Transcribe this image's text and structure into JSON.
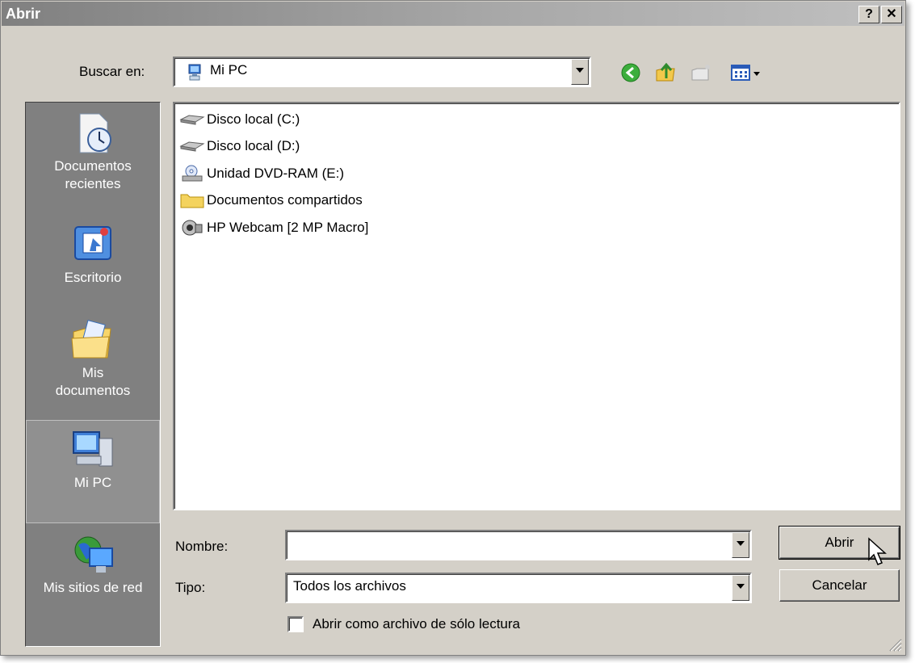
{
  "window": {
    "title": "Abrir",
    "help_label": "?",
    "close_label": "✕"
  },
  "lookin": {
    "label": "Buscar en:",
    "value": "Mi PC",
    "icon": "computer-icon"
  },
  "toolbar": {
    "back": "back-arrow-icon",
    "up": "up-folder-icon",
    "new_folder": "new-folder-icon",
    "views": "views-menu-icon"
  },
  "places": [
    {
      "label_line1": "Documentos",
      "label_line2": "recientes",
      "icon": "recent-documents-icon"
    },
    {
      "label_line1": "Escritorio",
      "label_line2": "",
      "icon": "desktop-icon"
    },
    {
      "label_line1": "Mis",
      "label_line2": "documentos",
      "icon": "my-documents-icon"
    },
    {
      "label_line1": "Mi PC",
      "label_line2": "",
      "icon": "my-computer-icon",
      "selected": true
    },
    {
      "label_line1": "Mis sitios de red",
      "label_line2": "",
      "icon": "network-places-icon"
    }
  ],
  "files": [
    {
      "name": "Disco local (C:)",
      "icon": "hard-drive-icon"
    },
    {
      "name": "Disco local (D:)",
      "icon": "hard-drive-icon"
    },
    {
      "name": "Unidad DVD-RAM (E:)",
      "icon": "dvd-drive-icon"
    },
    {
      "name": "Documentos compartidos",
      "icon": "folder-icon"
    },
    {
      "name": "HP Webcam [2 MP Macro]",
      "icon": "webcam-icon"
    }
  ],
  "filename": {
    "label": "Nombre:",
    "value": ""
  },
  "filetype": {
    "label": "Tipo:",
    "value": "Todos los archivos"
  },
  "readonly": {
    "label": "Abrir como archivo de sólo lectura",
    "checked": false
  },
  "buttons": {
    "open": "Abrir",
    "cancel": "Cancelar"
  },
  "colors": {
    "dialog_bg": "#d4d0c8",
    "places_bg": "#808080",
    "title_gradient_start": "#808080"
  }
}
